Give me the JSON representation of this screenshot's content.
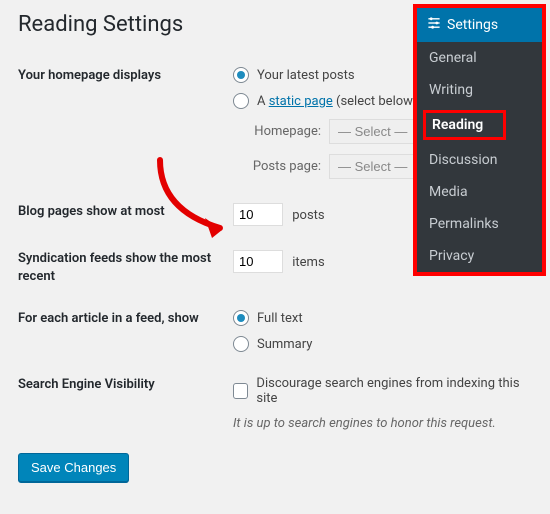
{
  "page": {
    "title": "Reading Settings"
  },
  "homepage": {
    "label": "Your homepage displays",
    "opt_latest": "Your latest posts",
    "opt_static_prefix": "A ",
    "opt_static_link": "static page",
    "opt_static_suffix": " (select below)",
    "homepage_label": "Homepage:",
    "postspage_label": "Posts page:",
    "select_placeholder": "— Select —"
  },
  "blogpages": {
    "label": "Blog pages show at most",
    "value": "10",
    "unit": "posts"
  },
  "syndication": {
    "label": "Syndication feeds show the most recent",
    "value": "10",
    "unit": "items"
  },
  "feed": {
    "label": "For each article in a feed, show",
    "full": "Full text",
    "summary": "Summary"
  },
  "visibility": {
    "label": "Search Engine Visibility",
    "checkbox": "Discourage search engines from indexing this site",
    "note": "It is up to search engines to honor this request."
  },
  "save": {
    "label": "Save Changes"
  },
  "sidebar": {
    "title": "Settings",
    "items": [
      "General",
      "Writing",
      "Reading",
      "Discussion",
      "Media",
      "Permalinks",
      "Privacy"
    ]
  }
}
